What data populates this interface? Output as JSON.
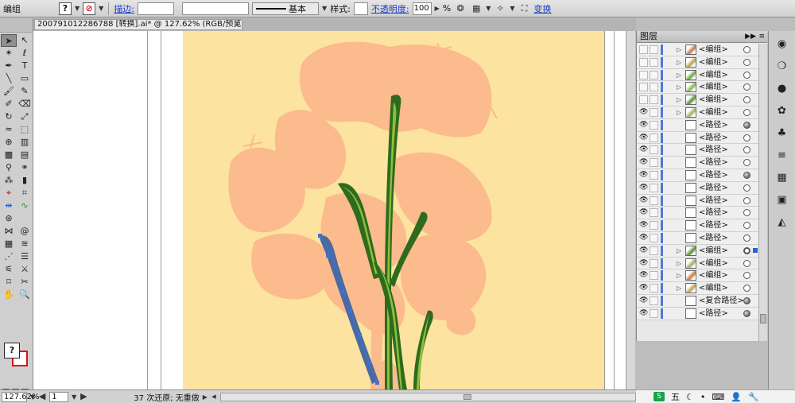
{
  "control_bar": {
    "object_type": "编组",
    "fill_symbol": "?",
    "stroke_label": "描边:",
    "stroke_style": "基本",
    "style_label": "样式:",
    "opacity_label": "不透明度:",
    "opacity_value": "100",
    "opacity_unit": "%",
    "transform_label": "变换"
  },
  "document_tab": {
    "title": "200791012286788 [转换].ai* @ 127.62% (RGB/预览)",
    "close": "✕"
  },
  "tools_panel": {
    "fill_symbol": "?"
  },
  "status_bar": {
    "zoom": "127.62%",
    "page": "1",
    "undo_info": "37 次还原; 无重做"
  },
  "layers_panel": {
    "title": "图层",
    "rows": [
      {
        "label": "<编组>",
        "visible": false,
        "has_arrow": true,
        "target": "empty"
      },
      {
        "label": "<编组>",
        "visible": false,
        "has_arrow": true,
        "target": "empty"
      },
      {
        "label": "<编组>",
        "visible": false,
        "has_arrow": true,
        "target": "empty"
      },
      {
        "label": "<编组>",
        "visible": false,
        "has_arrow": true,
        "target": "empty"
      },
      {
        "label": "<编组>",
        "visible": false,
        "has_arrow": true,
        "target": "empty"
      },
      {
        "label": "<编组>",
        "visible": true,
        "has_arrow": true,
        "target": "empty"
      },
      {
        "label": "<路径>",
        "visible": true,
        "has_arrow": false,
        "target": "full"
      },
      {
        "label": "<路径>",
        "visible": true,
        "has_arrow": false,
        "target": "empty"
      },
      {
        "label": "<路径>",
        "visible": true,
        "has_arrow": false,
        "target": "empty"
      },
      {
        "label": "<路径>",
        "visible": true,
        "has_arrow": false,
        "target": "empty"
      },
      {
        "label": "<路径>",
        "visible": true,
        "has_arrow": false,
        "target": "full"
      },
      {
        "label": "<路径>",
        "visible": true,
        "has_arrow": false,
        "target": "empty"
      },
      {
        "label": "<路径>",
        "visible": true,
        "has_arrow": false,
        "target": "empty"
      },
      {
        "label": "<路径>",
        "visible": true,
        "has_arrow": false,
        "target": "empty"
      },
      {
        "label": "<路径>",
        "visible": true,
        "has_arrow": false,
        "target": "empty"
      },
      {
        "label": "<路径>",
        "visible": true,
        "has_arrow": false,
        "target": "empty"
      },
      {
        "label": "<编组>",
        "visible": true,
        "has_arrow": true,
        "target": "ring",
        "selected": true
      },
      {
        "label": "<编组>",
        "visible": true,
        "has_arrow": true,
        "target": "empty"
      },
      {
        "label": "<编组>",
        "visible": true,
        "has_arrow": true,
        "target": "empty"
      },
      {
        "label": "<编组>",
        "visible": true,
        "has_arrow": true,
        "target": "empty"
      },
      {
        "label": "<复合路径>",
        "visible": true,
        "has_arrow": false,
        "target": "full"
      },
      {
        "label": "<路径>",
        "visible": true,
        "has_arrow": false,
        "target": "full"
      }
    ]
  },
  "ime_bar": {
    "mode": "五"
  },
  "colors": {
    "artboard": "#fce3a0",
    "flower": "#fbbb8d",
    "stem_dark": "#2e6b1f",
    "stem_light": "#8fbf3a",
    "selection_blue": "#3f6fd8",
    "link_blue": "#1a3fc4"
  }
}
